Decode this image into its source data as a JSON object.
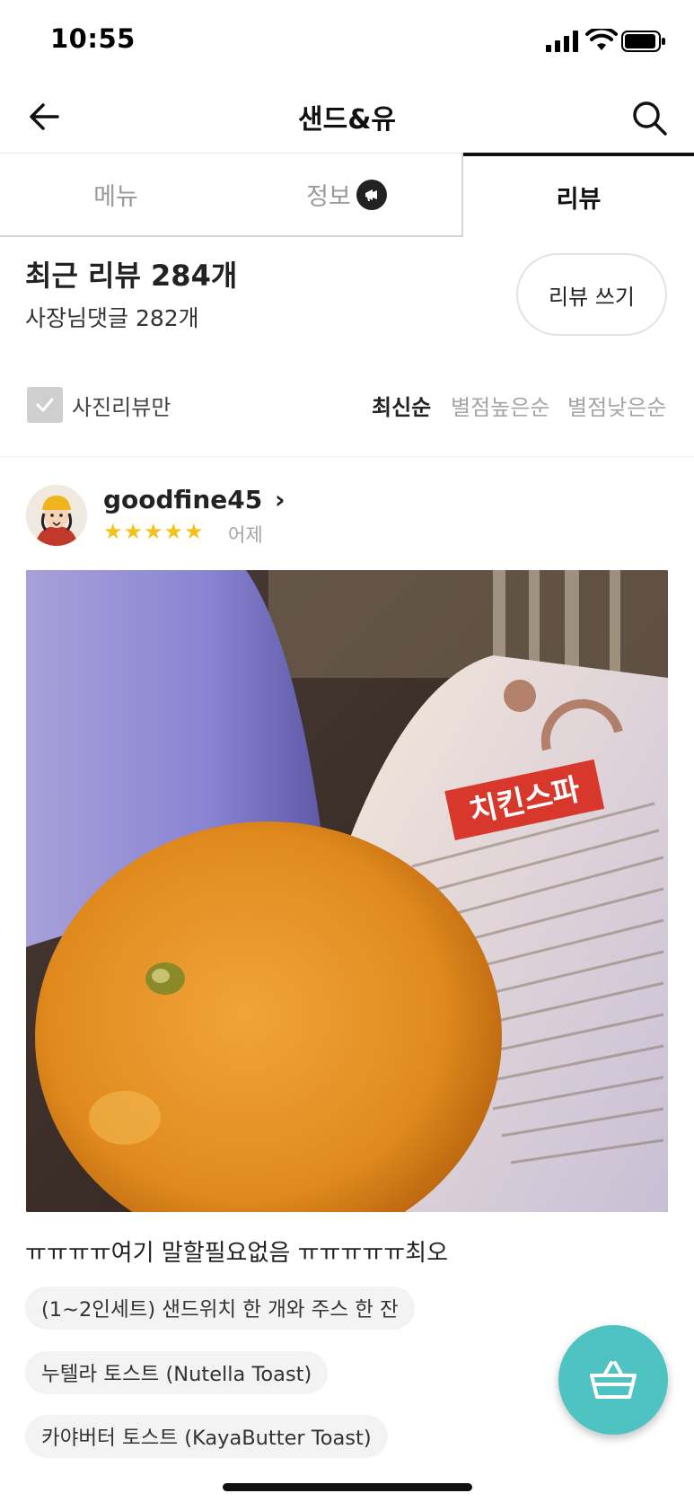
{
  "status_bar": {
    "time": "10:55"
  },
  "header": {
    "title": "샌드&유"
  },
  "tabs": [
    {
      "label": "메뉴",
      "active": false
    },
    {
      "label": "정보",
      "active": false
    },
    {
      "label": "리뷰",
      "active": true
    }
  ],
  "summary": {
    "recent_reviews": "최근 리뷰 284개",
    "owner_replies": "사장님댓글 282개",
    "write_button": "리뷰 쓰기"
  },
  "filters": {
    "photo_only": "사진리뷰만",
    "sort_options": [
      "최신순",
      "별점높은순",
      "별점낮은순"
    ],
    "selected_sort": "최신순"
  },
  "review": {
    "username": "goodfine45",
    "username_chevron": "›",
    "rating": 5,
    "stars": "★★★★★",
    "date": "어제",
    "photo_label_text": "치킨스파",
    "text": "ㅠㅠㅠㅠ여기 말할필요없음 ㅠㅠㅠㅠㅠ최오",
    "ordered_items": [
      "(1~2인세트) 샌드위치 한 개와 주스 한 잔",
      "누텔라 토스트 (Nutella Toast)",
      "카야버터 토스트 (KayaButter Toast)"
    ]
  },
  "colors": {
    "accent": "#4fc2c2",
    "star": "#f5c21b",
    "inactive_tab": "#9a9a9a"
  },
  "icons": [
    "back-arrow-icon",
    "search-icon",
    "megaphone-icon",
    "check-icon",
    "cart-icon"
  ]
}
